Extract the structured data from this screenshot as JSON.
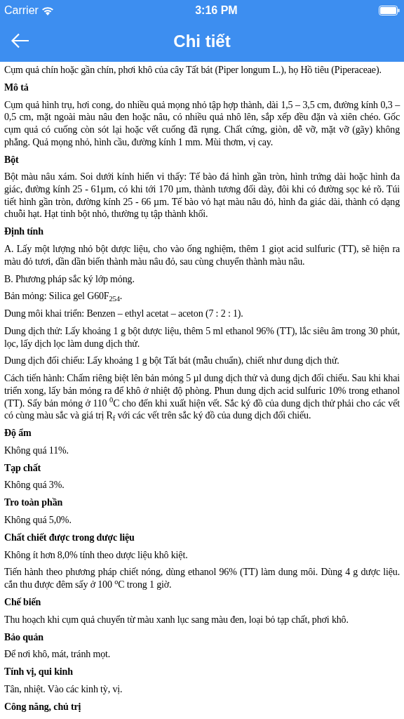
{
  "status_bar": {
    "carrier": "Carrier",
    "time": "3:16 PM"
  },
  "nav": {
    "title": "Chi tiết"
  },
  "blocks": [
    {
      "kind": "paragraph",
      "text": "Cụm quả chín hoặc gần chín, phơi khô của cây Tất bát (Piper longum L.), họ Hồ tiêu (Piperaceae)."
    },
    {
      "kind": "heading",
      "text": "Mô tả"
    },
    {
      "kind": "paragraph",
      "text": "Cụm quả hình trụ, hơi cong, do nhiều quả mọng nhỏ tập hợp thành, dài 1,5 – 3,5 cm, đường kính 0,3 – 0,5 cm, mặt ngoài màu nâu đen hoặc nâu, có nhiều quả nhô lên, sắp xếp đều đặn và xiên chéo. Gốc cụm quả có cuống còn sót lại hoặc vết cuống đã rụng. Chất cứng, giòn, dễ vỡ, mặt vỡ (gãy) không phẳng. Quả mọng nhỏ, hình cầu, đường kính 1 mm. Mùi thơm, vị cay."
    },
    {
      "kind": "heading",
      "text": "Bột"
    },
    {
      "kind": "paragraph",
      "text": "Bột màu nâu xám. Soi dưới kính hiển vi thấy: Tế bào đá hình gần tròn, hình trứng dài hoặc hình đa giác, đường kính 25 - 61µm, có khi tới 170 µm, thành tương đối dày, đôi khi có đường sọc kẻ rõ. Túi tiết hình gần tròn, đường kính 25 - 66 µm. Tế bào vỏ hạt màu nâu đỏ, hình đa giác dài, thành có dạng chuỗi hạt. Hạt tinh bột nhỏ, thường tụ tập thành khối."
    },
    {
      "kind": "heading",
      "text": "Định tính"
    },
    {
      "kind": "paragraph",
      "text": "A. Lấy một lượng nhỏ bột dược liệu, cho vào ống nghiệm, thêm 1 giọt acid sulfuric (TT), sẽ hiện ra màu đỏ tươi, dần dần biến thành màu nâu đỏ, sau cùng chuyển thành màu nâu."
    },
    {
      "kind": "paragraph",
      "text": "B. Phương pháp sắc ký lớp mỏng."
    },
    {
      "kind": "paragraph",
      "text": "Bản mỏng: Silica gel G60F$_{254}$."
    },
    {
      "kind": "paragraph",
      "text": "Dung môi khai triển: Benzen – ethyl acetat – aceton (7 : 2 : 1)."
    },
    {
      "kind": "paragraph",
      "text": "Dung dịch thử: Lấy khoảng 1 g bột dược liệu, thêm 5 ml ethanol 96% (TT), lắc siêu âm trong 30 phút, lọc, lấy dịch lọc làm dung dịch thử."
    },
    {
      "kind": "paragraph",
      "text": "Dung dịch đối chiếu: Lấy khoảng 1 g bột Tất bát (mẫu chuẩn), chiết như dung dịch thử."
    },
    {
      "kind": "paragraph",
      "text": "Cách tiến hành: Chấm riêng biệt lên bản mỏng 5 µl dung dịch thử và dung dịch đối chiếu. Sau khi khai triển xong, lấy bản mỏng ra để khô ở nhiệt độ phòng. Phun dung dịch acid sulfuric 10% trong ethanol (TT). Sấy bản mỏng ở 110 $^{0}$C cho đến khi xuất hiện vết. Sắc ký đồ của dung dịch thử phải cho các vết có cùng màu sắc và giá trị R$_{f}$ với các vết trên sắc ký đồ của dung dịch đối chiếu."
    },
    {
      "kind": "heading",
      "text": "Độ ẩm"
    },
    {
      "kind": "paragraph",
      "text": "Không quá 11%."
    },
    {
      "kind": "heading",
      "text": "Tạp chất"
    },
    {
      "kind": "paragraph",
      "text": "Không quá 3%."
    },
    {
      "kind": "heading",
      "text": "Tro toàn phần"
    },
    {
      "kind": "paragraph",
      "text": "Không quá 5,0%."
    },
    {
      "kind": "heading",
      "text": "Chất chiết được trong dược liệu"
    },
    {
      "kind": "paragraph",
      "text": "Không ít hơn 8,0% tính theo dược liệu khô kiệt."
    },
    {
      "kind": "paragraph",
      "text": "Tiến hành theo phương pháp chiết nóng, dùng ethanol 96% (TT) làm dung môi. Dùng 4 g dược liệu. cắn thu được đêm sấy ở 100 $^{o}$C trong 1 giờ."
    },
    {
      "kind": "heading",
      "text": "Chế biến"
    },
    {
      "kind": "paragraph",
      "text": "Thu hoạch khi cụm quả chuyển từ màu xanh lục sang màu đen, loại bỏ tạp chất, phơi khô."
    },
    {
      "kind": "heading",
      "text": "Bảo quản"
    },
    {
      "kind": "paragraph",
      "text": "Để nơi khô, mát, tránh mọt."
    },
    {
      "kind": "heading",
      "text": "Tính vị, qui kinh"
    },
    {
      "kind": "paragraph",
      "text": "Tân, nhiệt. Vào các kinh tỳ, vị."
    },
    {
      "kind": "heading",
      "text": "Công năng, chủ trị"
    }
  ]
}
